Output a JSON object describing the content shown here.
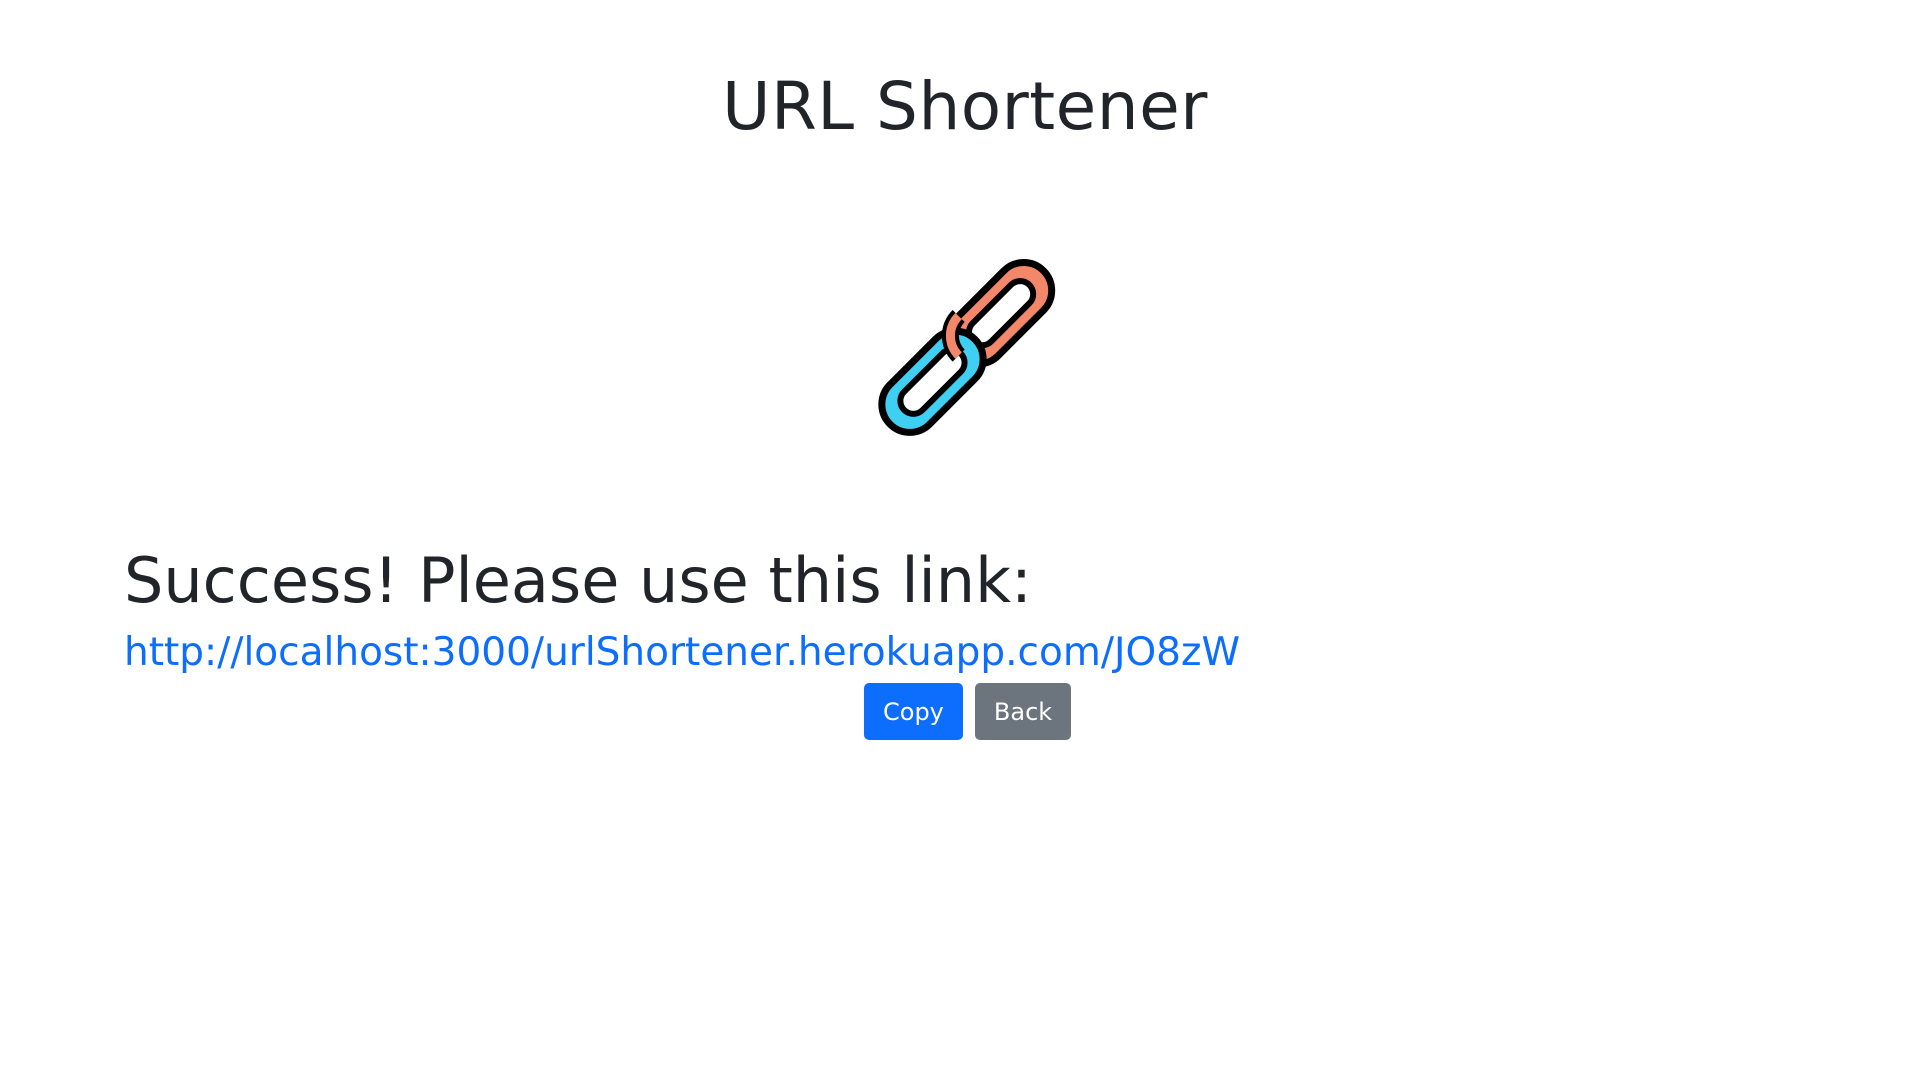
{
  "header": {
    "title": "URL Shortener"
  },
  "logo": {
    "icon": "chain-link-icon",
    "colors": {
      "blue_link": "#3fcff3",
      "orange_link": "#f3876a",
      "outline": "#000000"
    }
  },
  "result": {
    "heading": "Success!  Please use this link:",
    "link": "http://localhost:3000/urlShortener.herokuapp.com/JO8zW"
  },
  "actions": {
    "copy_label": "Copy",
    "back_label": "Back"
  },
  "theme": {
    "primary": "#0d6efd",
    "secondary": "#6c757d",
    "text": "#212529"
  }
}
